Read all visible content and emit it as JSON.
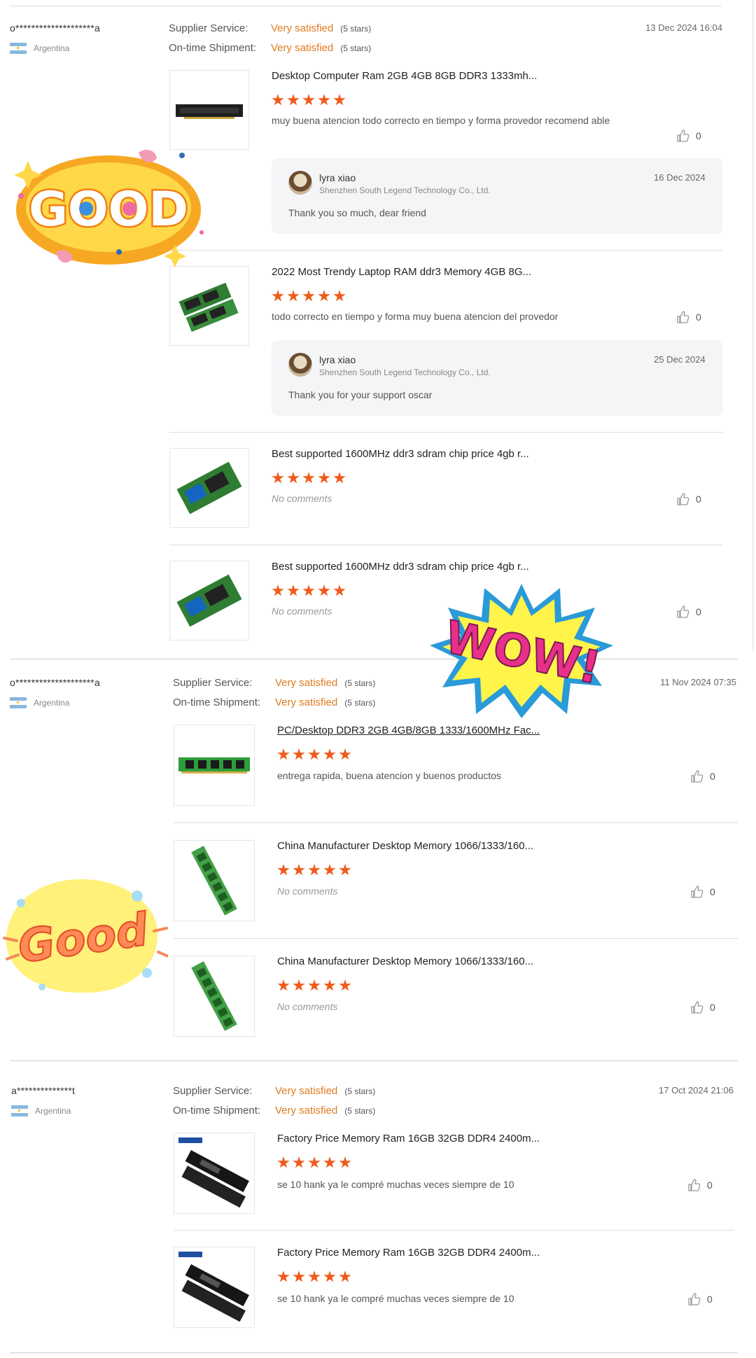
{
  "labels": {
    "supplier_service": "Supplier Service:",
    "ontime_shipment": "On-time Shipment:",
    "no_comments": "No comments"
  },
  "stickers": {
    "good_top": "GOOD",
    "wow": "WOW!",
    "good_bottom": "Good"
  },
  "reviews": [
    {
      "buyer": "o********************a",
      "country": "Argentina",
      "supplier_rating": "Very satisfied",
      "supplier_stars": "(5 stars)",
      "shipment_rating": "Very satisfied",
      "shipment_stars": "(5 stars)",
      "date": "13 Dec 2024 16:04",
      "items": [
        {
          "title": "Desktop Computer Ram 2GB 4GB 8GB DDR3 1333mh...",
          "rating": 5,
          "comment": "muy buena atencion todo correcto en tiempo y forma provedor recomend able",
          "likes": "0",
          "reply": {
            "name": "lyra xiao",
            "company": "Shenzhen South Legend Technology Co., Ltd.",
            "date": "16 Dec 2024",
            "text": "Thank you so much, dear friend"
          }
        },
        {
          "title": "2022 Most Trendy Laptop RAM ddr3 Memory 4GB 8G...",
          "rating": 5,
          "comment": "todo correcto en tiempo y forma muy buena atencion del provedor",
          "likes": "0",
          "reply": {
            "name": "lyra xiao",
            "company": "Shenzhen South Legend Technology Co., Ltd.",
            "date": "25 Dec 2024",
            "text": "Thank you for your support oscar"
          }
        },
        {
          "title": "Best supported 1600MHz ddr3 sdram chip price 4gb r...",
          "rating": 5,
          "comment": "",
          "likes": "0"
        },
        {
          "title": "Best supported 1600MHz ddr3 sdram chip price 4gb r...",
          "rating": 5,
          "comment": "",
          "likes": "0"
        }
      ]
    },
    {
      "buyer": "o********************a",
      "country": "Argentina",
      "supplier_rating": "Very satisfied",
      "supplier_stars": "(5 stars)",
      "shipment_rating": "Very satisfied",
      "shipment_stars": "(5 stars)",
      "date": "11 Nov 2024 07:35",
      "items": [
        {
          "title": "PC/Desktop DDR3 2GB 4GB/8GB 1333/1600MHz Fac...",
          "rating": 5,
          "comment": "entrega rapida, buena atencion y buenos productos",
          "likes": "0"
        },
        {
          "title": "China Manufacturer Desktop Memory 1066/1333/160...",
          "rating": 5,
          "comment": "",
          "likes": "0"
        },
        {
          "title": "China Manufacturer Desktop Memory 1066/1333/160...",
          "rating": 5,
          "comment": "",
          "likes": "0"
        }
      ]
    },
    {
      "buyer": "a**************t",
      "country": "Argentina",
      "supplier_rating": "Very satisfied",
      "supplier_stars": "(5 stars)",
      "shipment_rating": "Very satisfied",
      "shipment_stars": "(5 stars)",
      "date": "17 Oct 2024 21:06",
      "items": [
        {
          "title": "Factory Price Memory Ram 16GB 32GB DDR4 2400m...",
          "rating": 5,
          "comment": "se 10 hank ya le compré muchas veces siempre de 10",
          "likes": "0"
        },
        {
          "title": "Factory Price Memory Ram 16GB 32GB DDR4 2400m...",
          "rating": 5,
          "comment": "se 10 hank ya le compré muchas veces siempre de 10",
          "likes": "0"
        }
      ]
    }
  ]
}
